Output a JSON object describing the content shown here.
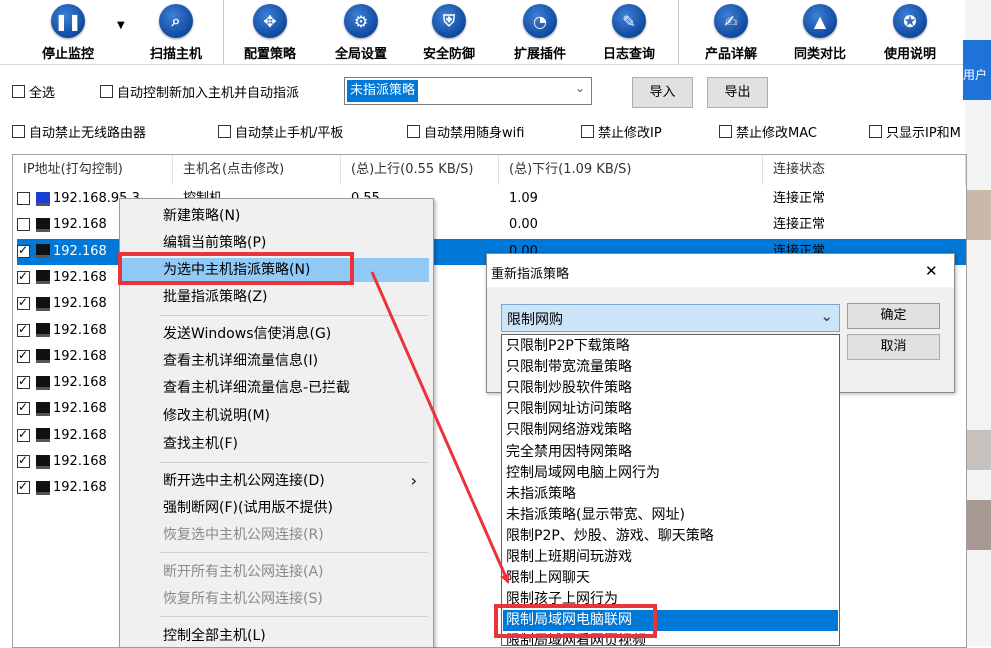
{
  "toolbar": {
    "buttons": [
      {
        "label": "停止监控",
        "icon": "pause-icon",
        "glyph": "❚❚"
      },
      {
        "label": "扫描主机",
        "icon": "magnifier-icon",
        "glyph": "⌕"
      },
      {
        "label": "配置策略",
        "icon": "move-arrows-icon",
        "glyph": "✥"
      },
      {
        "label": "全局设置",
        "icon": "gear-icon",
        "glyph": "⚙"
      },
      {
        "label": "安全防御",
        "icon": "shield-icon",
        "glyph": "⛨"
      },
      {
        "label": "扩展插件",
        "icon": "pie-chart-icon",
        "glyph": "◔"
      },
      {
        "label": "日志查询",
        "icon": "log-book-icon",
        "glyph": "✎"
      },
      {
        "label": "产品详解",
        "icon": "edit-document-icon",
        "glyph": "✍"
      },
      {
        "label": "同类对比",
        "icon": "graduation-cap-icon",
        "glyph": "▲"
      },
      {
        "label": "使用说明",
        "icon": "medal-icon",
        "glyph": "✪"
      }
    ],
    "dropdown_glyph": "▼"
  },
  "options": {
    "select_all": "全选",
    "auto_control": "自动控制新加入主机并自动指派",
    "policy_select_value": "未指派策略",
    "import_label": "导入",
    "export_label": "导出",
    "row2": [
      "自动禁止无线路由器",
      "自动禁止手机/平板",
      "自动禁用随身wifi",
      "禁止修改IP",
      "禁止修改MAC",
      "只显示IP和M"
    ]
  },
  "table": {
    "headers": [
      "IP地址(打勾控制)",
      "主机名(点击修改)",
      "(总)上行(0.55 KB/S)",
      "(总)下行(1.09 KB/S)",
      "连接状态"
    ],
    "rows": [
      {
        "checked": false,
        "ip": "192.168.95.3",
        "host": "控制机",
        "up": "0.55",
        "down": "1.09",
        "status": "连接正常"
      },
      {
        "checked": false,
        "ip": "192.168",
        "host": "",
        "up": "",
        "down": "0.00",
        "status": "连接正常"
      },
      {
        "checked": true,
        "ip": "192.168",
        "host": "",
        "up": "",
        "down": "0.00",
        "status": "连接正常"
      },
      {
        "checked": true,
        "ip": "192.168",
        "host": "",
        "up": "",
        "down": "",
        "status": ""
      },
      {
        "checked": true,
        "ip": "192.168",
        "host": "",
        "up": "",
        "down": "",
        "status": ""
      },
      {
        "checked": true,
        "ip": "192.168",
        "host": "",
        "up": "",
        "down": "",
        "status": ""
      },
      {
        "checked": true,
        "ip": "192.168",
        "host": "",
        "up": "",
        "down": "",
        "status": ""
      },
      {
        "checked": true,
        "ip": "192.168",
        "host": "",
        "up": "",
        "down": "",
        "status": ""
      },
      {
        "checked": true,
        "ip": "192.168",
        "host": "",
        "up": "",
        "down": "",
        "status": ""
      },
      {
        "checked": true,
        "ip": "192.168",
        "host": "",
        "up": "",
        "down": "",
        "status": ""
      },
      {
        "checked": true,
        "ip": "192.168",
        "host": "",
        "up": "",
        "down": "",
        "status": ""
      },
      {
        "checked": true,
        "ip": "192.168",
        "host": "",
        "up": "",
        "down": "",
        "status": ""
      }
    ]
  },
  "context_menu": {
    "submenu_arrow": "›",
    "items": [
      {
        "label": "新建策略(N)",
        "disabled": false
      },
      {
        "label": "编辑当前策略(P)",
        "disabled": false
      },
      {
        "label": "为选中主机指派策略(N)",
        "disabled": false,
        "highlighted": true
      },
      {
        "label": "批量指派策略(Z)",
        "disabled": false
      },
      {
        "label": "发送Windows信使消息(G)",
        "disabled": false
      },
      {
        "label": "查看主机详细流量信息(I)",
        "disabled": false
      },
      {
        "label": "查看主机详细流量信息-已拦截",
        "disabled": false
      },
      {
        "label": "修改主机说明(M)",
        "disabled": false
      },
      {
        "label": "查找主机(F)",
        "disabled": false
      },
      {
        "label": "断开选中主机公网连接(D)",
        "disabled": false,
        "submenu": true
      },
      {
        "label": "强制断网(F)(试用版不提供)",
        "disabled": false
      },
      {
        "label": "恢复选中主机公网连接(R)",
        "disabled": true
      },
      {
        "label": "断开所有主机公网连接(A)",
        "disabled": true
      },
      {
        "label": "恢复所有主机公网连接(S)",
        "disabled": true
      },
      {
        "label": "控制全部主机(L)",
        "disabled": false
      }
    ]
  },
  "dialog": {
    "title": "重新指派策略",
    "close_glyph": "✕",
    "combo_value": "限制网购",
    "combo_arrow": "⌄",
    "ok_label": "确定",
    "cancel_label": "取消",
    "options": [
      "只限制P2P下载策略",
      "只限制带宽流量策略",
      "只限制炒股软件策略",
      "只限制网址访问策略",
      "只限制网络游戏策略",
      "完全禁用因特网策略",
      "控制局域网电脑上网行为",
      "未指派策略",
      "未指派策略(显示带宽、网址)",
      "限制P2P、炒股、游戏、聊天策略",
      "限制上班期间玩游戏",
      "限制上网聊天",
      "限制孩子上网行为",
      "限制局域网电脑联网",
      "限制局域网看网页视频"
    ],
    "highlighted_index": 13
  },
  "side_strip": {
    "text": "用户"
  },
  "colors": {
    "accent": "#0078d7",
    "annotation_red": "#e8343a",
    "menu_highlight": "#91c9f7",
    "combo_fill": "#cce4f7",
    "icon_blue": "#0e4a9f"
  }
}
